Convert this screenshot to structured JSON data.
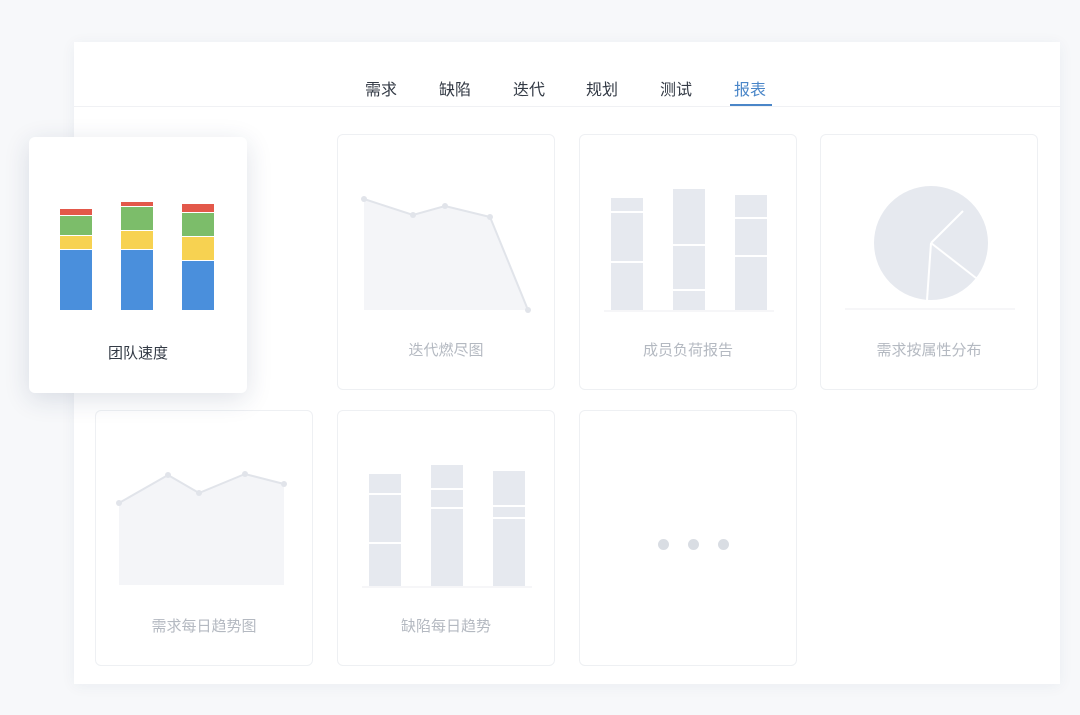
{
  "tabs": [
    {
      "label": "需求",
      "active": false
    },
    {
      "label": "缺陷",
      "active": false
    },
    {
      "label": "迭代",
      "active": false
    },
    {
      "label": "规划",
      "active": false
    },
    {
      "label": "测试",
      "active": false
    },
    {
      "label": "报表",
      "active": true
    }
  ],
  "reports": [
    {
      "label": "团队速度",
      "icon": "stacked-bar-chart-icon",
      "highlighted": true
    },
    {
      "label": "迭代燃尽图",
      "icon": "burndown-area-chart-icon",
      "highlighted": false
    },
    {
      "label": "成员负荷报告",
      "icon": "bar-chart-icon",
      "highlighted": false
    },
    {
      "label": "需求按属性分布",
      "icon": "pie-chart-icon",
      "highlighted": false
    },
    {
      "label": "需求每日趋势图",
      "icon": "area-chart-icon",
      "highlighted": false
    },
    {
      "label": "缺陷每日趋势",
      "icon": "bar-chart-icon",
      "highlighted": false
    },
    {
      "label": "",
      "icon": "more-icon",
      "highlighted": false
    }
  ],
  "colors": {
    "accent": "#4a86c8",
    "bar_blue": "#4a8fdc",
    "bar_yellow": "#f7d251",
    "bar_green": "#7cbd6a",
    "bar_red": "#e3584a",
    "placeholder_fill": "#e6e9ef"
  }
}
